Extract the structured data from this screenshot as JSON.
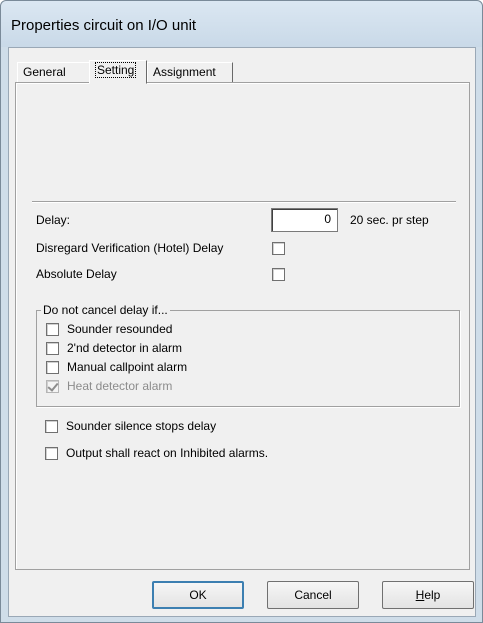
{
  "window": {
    "title": "Properties circuit on I/O unit"
  },
  "tabs": [
    {
      "label": "General"
    },
    {
      "label": "Setting"
    },
    {
      "label": "Assignment"
    }
  ],
  "setting": {
    "delay_label": "Delay:",
    "delay_value": "0",
    "delay_unit": "20 sec. pr step",
    "disregard_label": "Disregard Verification (Hotel) Delay",
    "disregard_checked": false,
    "absolute_label": "Absolute Delay",
    "absolute_checked": false
  },
  "group": {
    "title": "Do not cancel delay if...",
    "items": [
      {
        "label": "Sounder resounded",
        "checked": false,
        "enabled": true
      },
      {
        "label": "2'nd detector in alarm",
        "checked": false,
        "enabled": true
      },
      {
        "label": "Manual callpoint alarm",
        "checked": false,
        "enabled": true
      },
      {
        "label": "Heat detector alarm",
        "checked": true,
        "enabled": false
      }
    ]
  },
  "options": [
    {
      "label": "Sounder silence stops delay",
      "checked": false
    },
    {
      "label": "Output shall react on Inhibited alarms.",
      "checked": false
    }
  ],
  "buttons": {
    "ok": "OK",
    "cancel": "Cancel",
    "help_first": "H",
    "help_rest": "elp"
  }
}
